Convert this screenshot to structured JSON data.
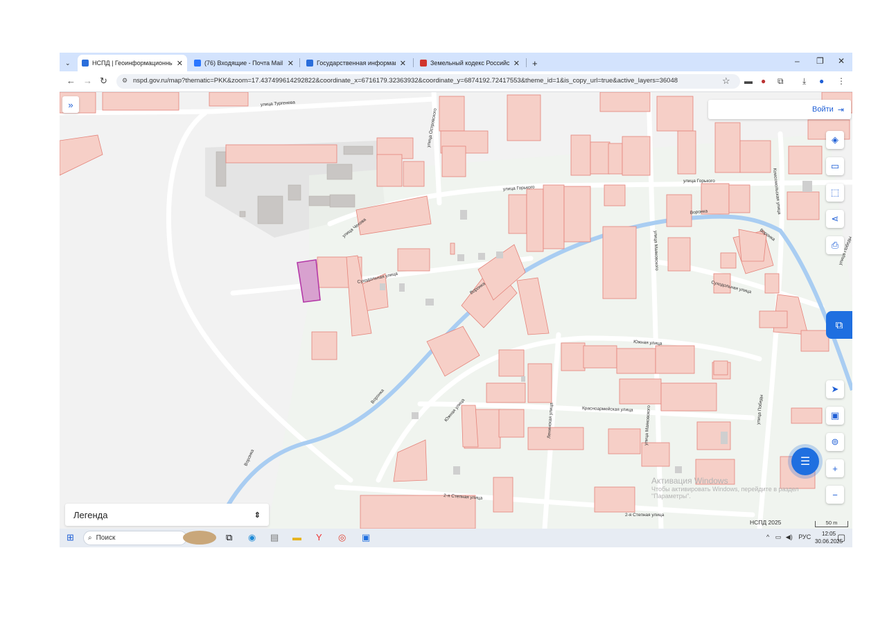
{
  "browser": {
    "tabs": [
      {
        "title": "НСПД | Геоинформационный",
        "active": true,
        "color": "#2a6edb"
      },
      {
        "title": "(76) Входящие - Почта Mail",
        "active": false,
        "color": "#2b77ff"
      },
      {
        "title": "Государственная информаци",
        "active": false,
        "color": "#2a6edb"
      },
      {
        "title": "Земельный кодекс Российско",
        "active": false,
        "color": "#d0342c"
      }
    ],
    "new_tab": "+",
    "url": "nspd.gov.ru/map?thematic=PKK&zoom=17.437499614292822&coordinate_x=6716179.32363932&coordinate_y=6874192.72417553&theme_id=1&is_copy_url=true&active_layers=36048"
  },
  "map": {
    "login_label": "Войти",
    "legend_label": "Легенда",
    "scale_label": "НСПД 2025",
    "scale_bar_label": "50 m",
    "streets": [
      "улица Тургенева",
      "улица Островского",
      "улица Горького",
      "улица Горького",
      "улица Чехова",
      "Суходольная улица",
      "улица Маяковского",
      "Суходольная улица",
      "Южная улица",
      "Южная улица",
      "Красноармейская улица",
      "улица Маяковского",
      "Ленинская улица",
      "2-я Степная улица",
      "2-я Степная улица",
      "улица Победы",
      "Комсомольская улица",
      "улица Победы",
      "Воронка",
      "Воронка",
      "Воронка",
      "Воронка",
      "Воронка"
    ],
    "watermark_title": "Активация Windows",
    "watermark_text": "Чтобы активировать Windows, перейдите в раздел \"Параметры\".",
    "colors": {
      "parcel": "#f6cfc7",
      "parcel_stroke": "#e4837a",
      "river": "#a9cdf2",
      "selected": "#b43aa8"
    }
  },
  "taskbar": {
    "search_label": "Поиск",
    "tray_lang": "РУС",
    "time": "12:05",
    "date": "30.06.2025"
  }
}
